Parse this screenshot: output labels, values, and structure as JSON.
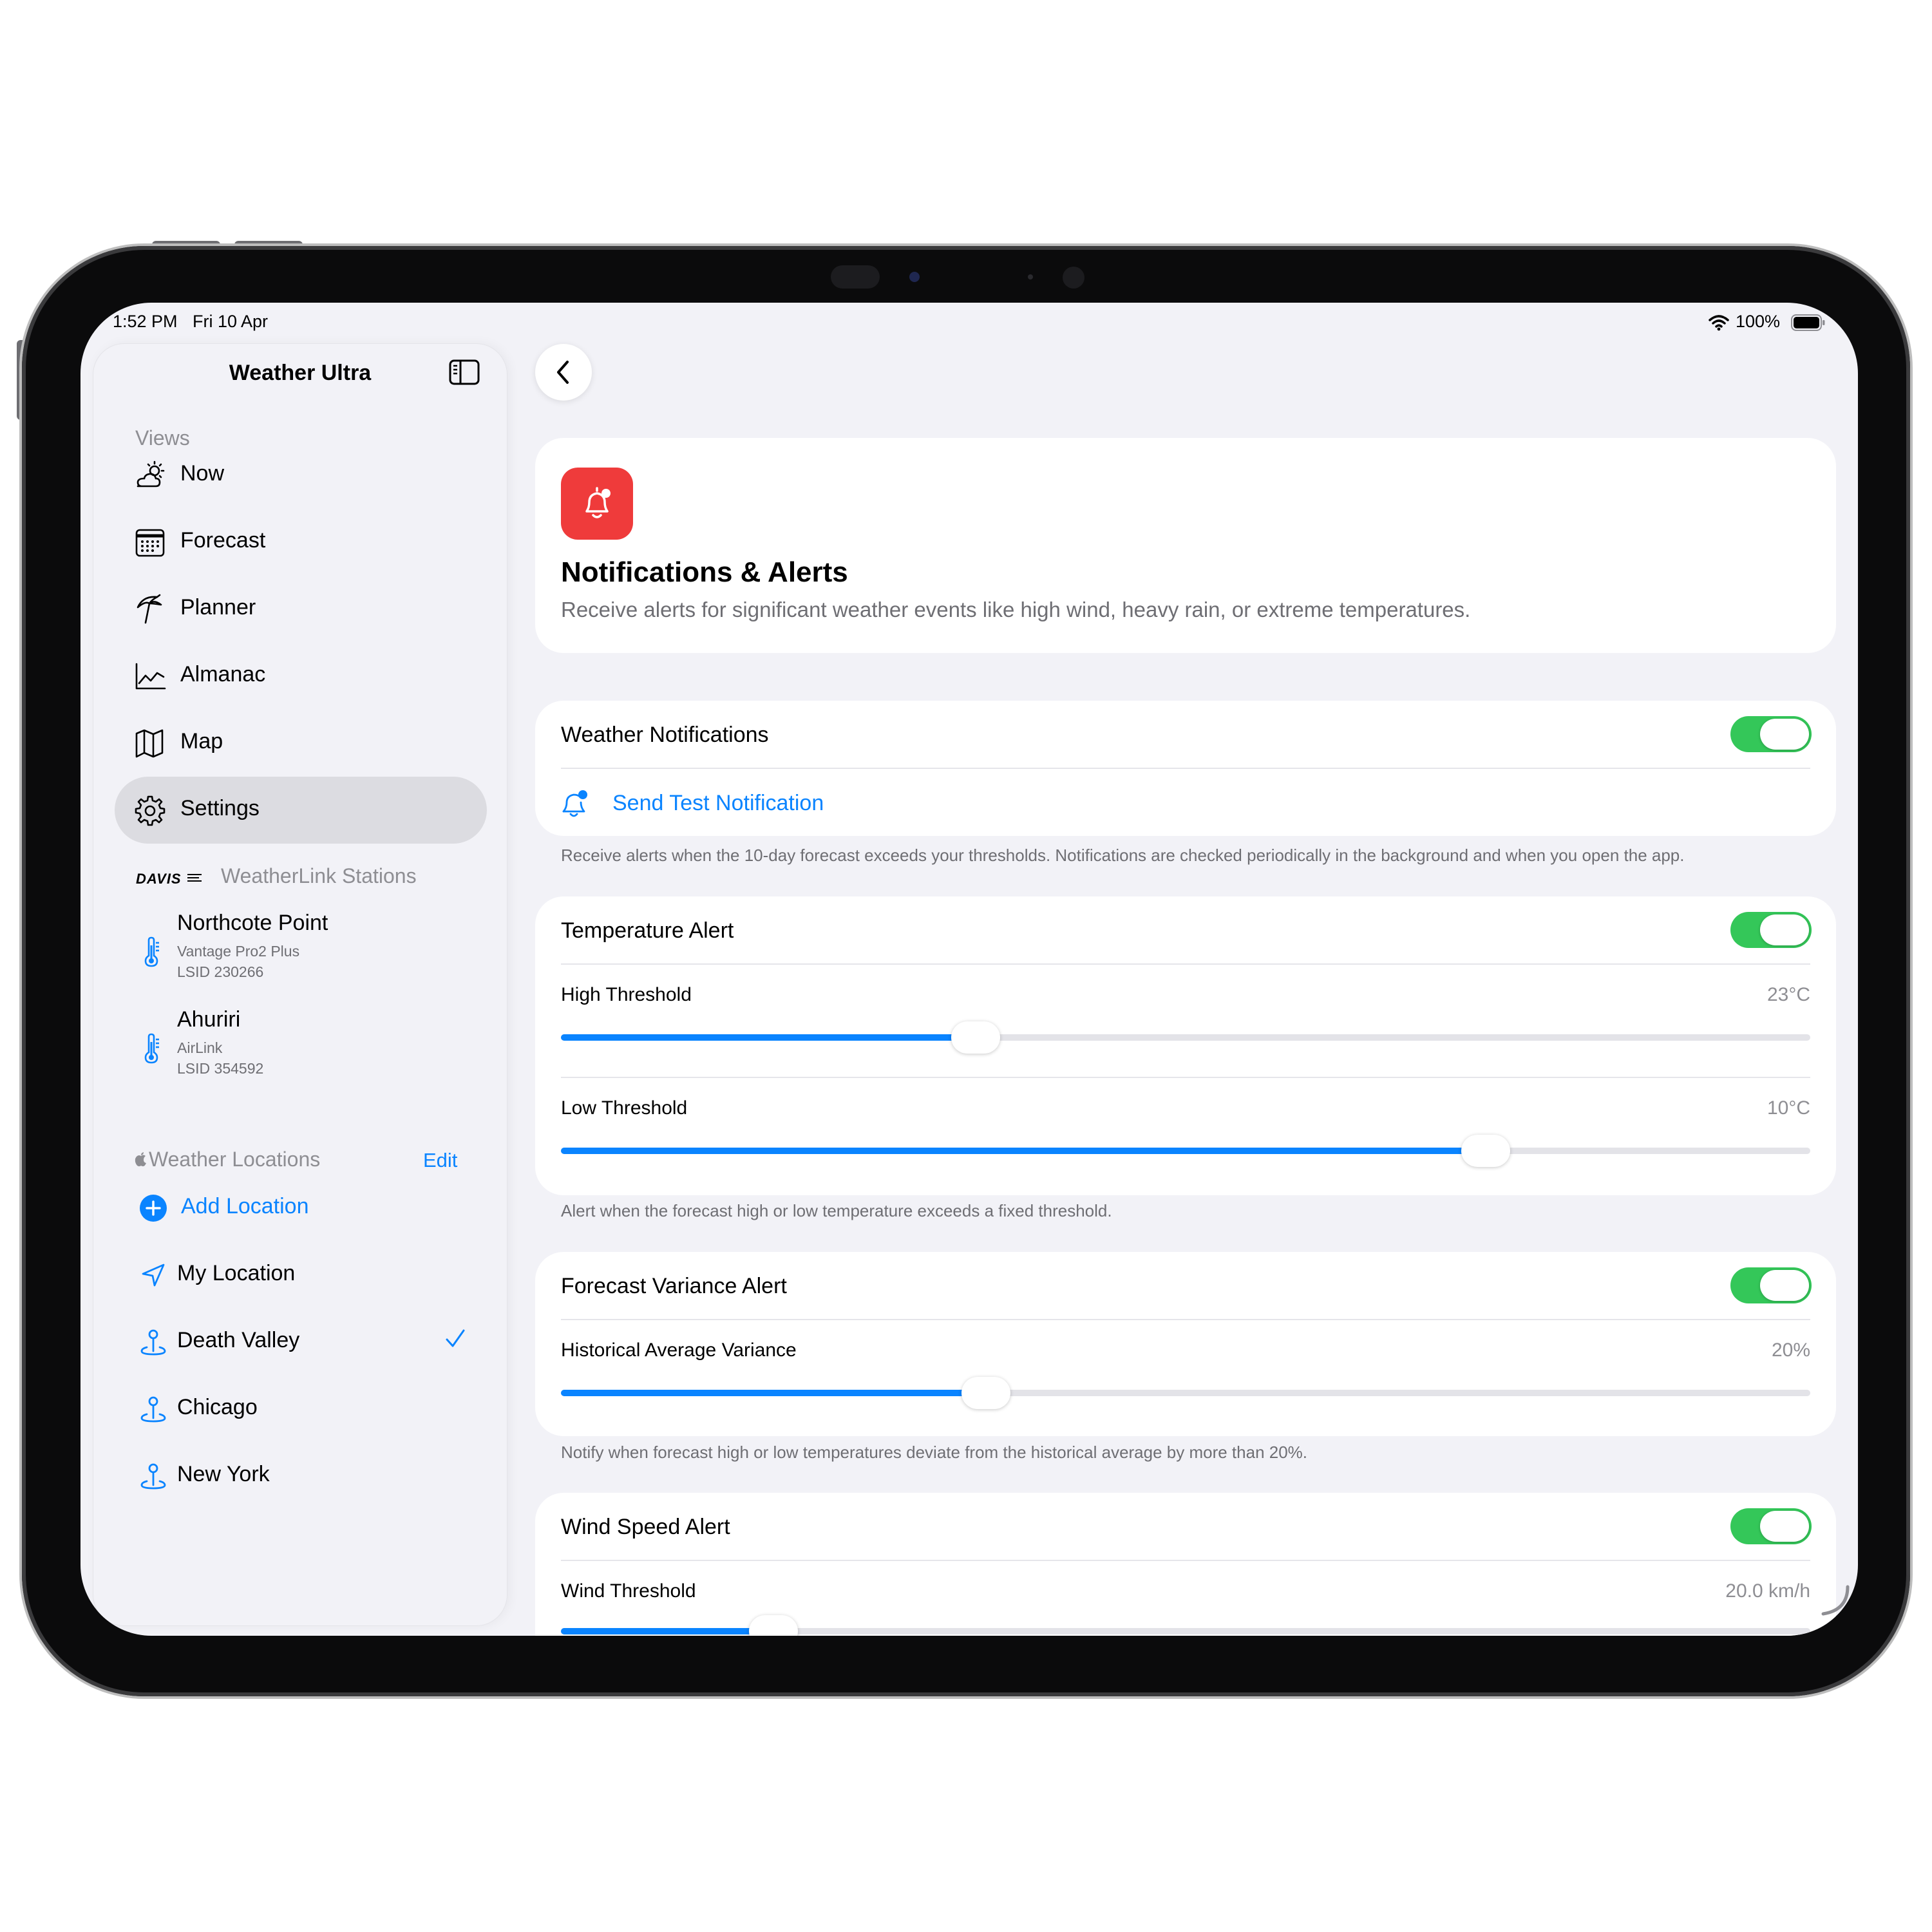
{
  "status_bar": {
    "time": "1:52 PM",
    "date": "Fri 10 Apr",
    "battery": "100%"
  },
  "sidebar": {
    "title": "Weather Ultra",
    "views_header": "Views",
    "views": [
      {
        "label": "Now",
        "icon": "cloud-sun-icon"
      },
      {
        "label": "Forecast",
        "icon": "calendar-icon"
      },
      {
        "label": "Planner",
        "icon": "beach-umbrella-icon"
      },
      {
        "label": "Almanac",
        "icon": "line-chart-icon"
      },
      {
        "label": "Map",
        "icon": "map-icon"
      },
      {
        "label": "Settings",
        "icon": "gear-icon",
        "selected": true
      }
    ],
    "stations_brand": "DAVIS",
    "stations_header": "WeatherLink Stations",
    "stations": [
      {
        "name": "Northcote Point",
        "model": "Vantage Pro2 Plus",
        "lsid": "LSID 230266"
      },
      {
        "name": "Ahuriri",
        "model": "AirLink",
        "lsid": "LSID 354592"
      }
    ],
    "locations_header": "Weather Locations",
    "locations_edit": "Edit",
    "add_location": "Add Location",
    "my_location": "My Location",
    "locations": [
      {
        "label": "Death Valley",
        "checked": true
      },
      {
        "label": "Chicago",
        "checked": false
      },
      {
        "label": "New York",
        "checked": false
      }
    ]
  },
  "header_card": {
    "title": "Notifications & Alerts",
    "description": "Receive alerts for significant weather events like high wind, heavy rain, or extreme temperatures.",
    "icon_color": "#ef3b3b"
  },
  "notifications": {
    "label": "Weather Notifications",
    "enabled": true,
    "test_button": "Send Test Notification",
    "footer": "Receive alerts when the 10-day forecast exceeds your thresholds. Notifications are checked periodically in the background and when you open the app."
  },
  "temperature": {
    "label": "Temperature Alert",
    "enabled": true,
    "high_label": "High Threshold",
    "high_value": "23°C",
    "high_fraction": 0.332,
    "low_label": "Low Threshold",
    "low_value": "10°C",
    "low_fraction": 0.74,
    "footer": "Alert when the forecast high or low temperature exceeds a fixed threshold."
  },
  "variance": {
    "label": "Forecast Variance Alert",
    "enabled": true,
    "slider_label": "Historical Average Variance",
    "value": "20%",
    "fraction": 0.34,
    "footer": "Notify when forecast high or low temperatures deviate from the historical average by more than 20%."
  },
  "wind": {
    "label": "Wind Speed Alert",
    "enabled": true,
    "slider_label": "Wind Threshold",
    "value": "20.0 km/h",
    "fraction": 0.17
  },
  "colors": {
    "accent": "#0a84ff",
    "toggle_on": "#34c759",
    "selection": "#dcdce1"
  }
}
